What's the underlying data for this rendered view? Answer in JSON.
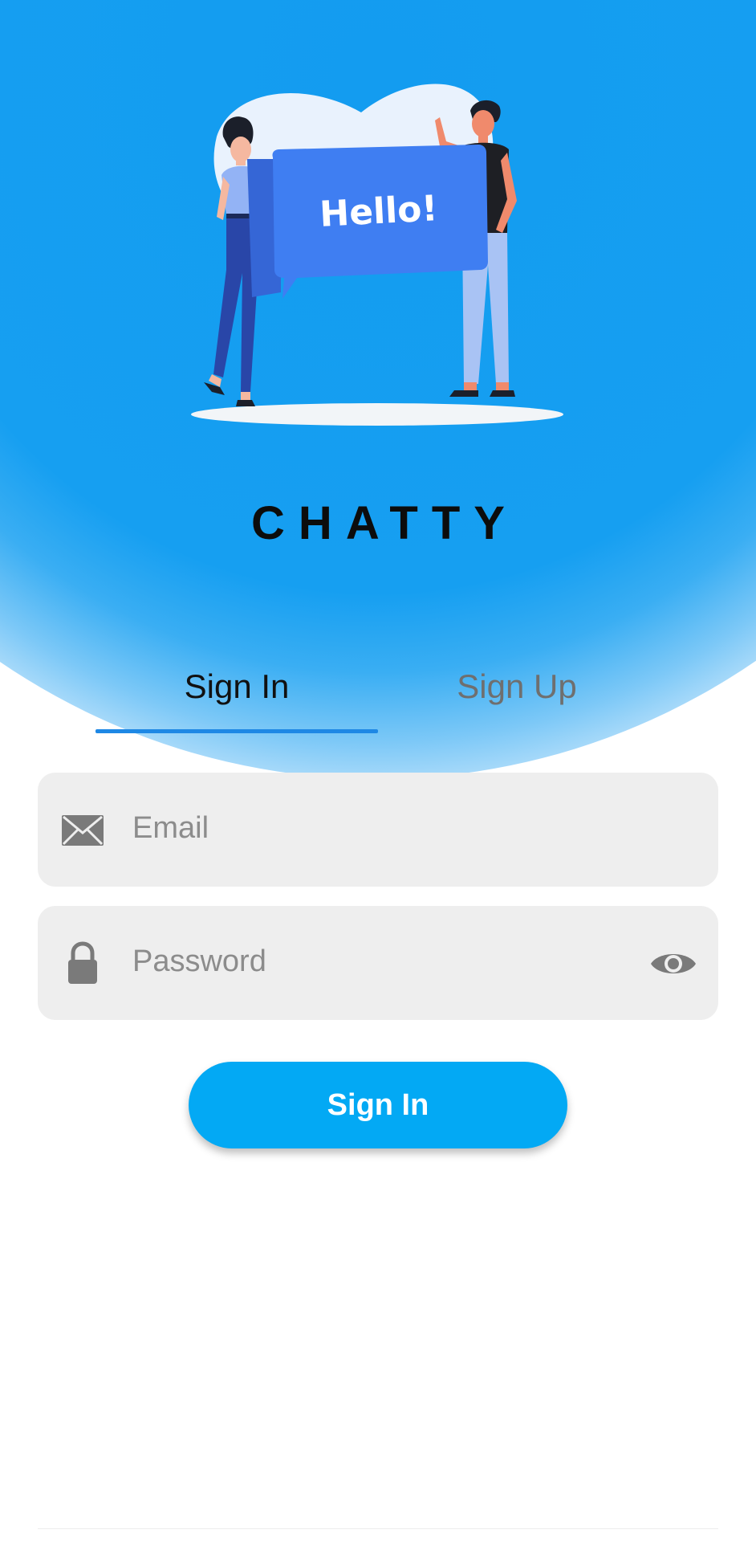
{
  "app": {
    "title": "CHATTY",
    "illustration_text": "Hello!"
  },
  "tabs": [
    {
      "label": "Sign In",
      "active": true
    },
    {
      "label": "Sign Up",
      "active": false
    }
  ],
  "form": {
    "email": {
      "placeholder": "Email",
      "value": "",
      "icon": "mail-icon"
    },
    "password": {
      "placeholder": "Password",
      "value": "",
      "icon": "lock-icon",
      "toggle_icon": "eye-icon"
    },
    "submit_label": "Sign In"
  },
  "colors": {
    "hero_blue": "#139cf0",
    "tab_underline": "#1e88e5",
    "button": "#03a9f4",
    "field_bg": "#eeeeee"
  }
}
